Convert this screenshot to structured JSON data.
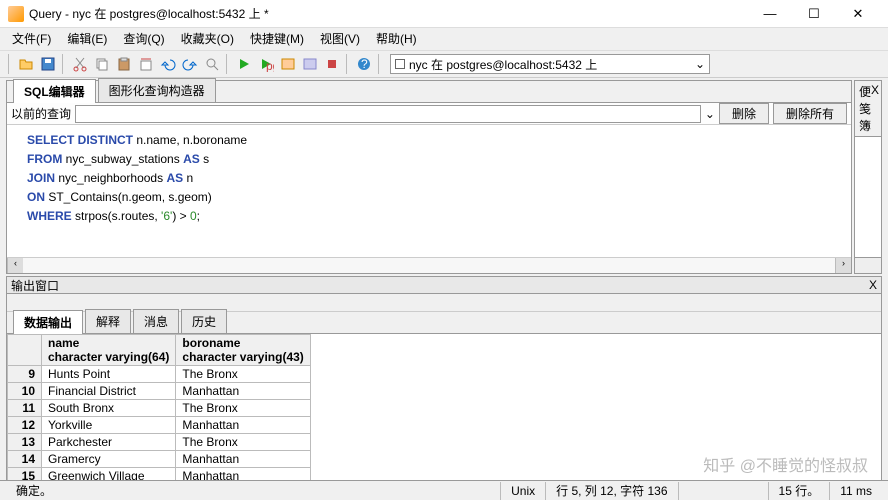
{
  "title": "Query - nyc 在 postgres@localhost:5432 上 *",
  "menu": {
    "file": "文件(F)",
    "edit": "编辑(E)",
    "query": "查询(Q)",
    "fav": "收藏夹(O)",
    "macro": "快捷键(M)",
    "view": "视图(V)",
    "help": "帮助(H)"
  },
  "toolbar": {
    "db_label": "nyc 在 postgres@localhost:5432 上"
  },
  "tabs": {
    "sql": "SQL编辑器",
    "graphical": "图形化查询构造器"
  },
  "subbar": {
    "label": "以前的查询",
    "delete": "删除",
    "delete_all": "删除所有"
  },
  "sql": {
    "line1_a": "SELECT DISTINCT",
    "line1_b": " n.name, n.boroname",
    "line2_a": "FROM",
    "line2_b": " nyc_subway_stations ",
    "line2_c": "AS",
    "line2_d": " s",
    "line3_a": "JOIN",
    "line3_b": " nyc_neighborhoods ",
    "line3_c": "AS",
    "line3_d": " n",
    "line4_a": "ON",
    "line4_b": " ST_Contains(n.geom, s.geom)",
    "line5_a": "WHERE",
    "line5_b": " strpos(s.routes, ",
    "line5_c": "'6'",
    "line5_d": ") > ",
    "line5_e": "0",
    "line5_f": ";"
  },
  "scratch": {
    "title": "便笺簿",
    "close": "X"
  },
  "output": {
    "title": "输出窗口",
    "close": "X",
    "tabs": {
      "data": "数据输出",
      "explain": "解释",
      "msg": "消息",
      "hist": "历史"
    },
    "columns": [
      {
        "name": "name",
        "type": "character varying(64)"
      },
      {
        "name": "boroname",
        "type": "character varying(43)"
      }
    ],
    "rows": [
      {
        "n": "9",
        "name": "Hunts Point",
        "boro": "The Bronx"
      },
      {
        "n": "10",
        "name": "Financial District",
        "boro": "Manhattan"
      },
      {
        "n": "11",
        "name": "South Bronx",
        "boro": "The Bronx"
      },
      {
        "n": "12",
        "name": "Yorkville",
        "boro": "Manhattan"
      },
      {
        "n": "13",
        "name": "Parkchester",
        "boro": "The Bronx"
      },
      {
        "n": "14",
        "name": "Gramercy",
        "boro": "Manhattan"
      },
      {
        "n": "15",
        "name": "Greenwich Village",
        "boro": "Manhattan"
      }
    ]
  },
  "status": {
    "ready": "确定。",
    "mode": "Unix",
    "pos": "行 5, 列 12, 字符 136",
    "rows": "15 行。",
    "time": "11 ms"
  },
  "watermark": "知乎 @不睡觉的怪叔叔"
}
